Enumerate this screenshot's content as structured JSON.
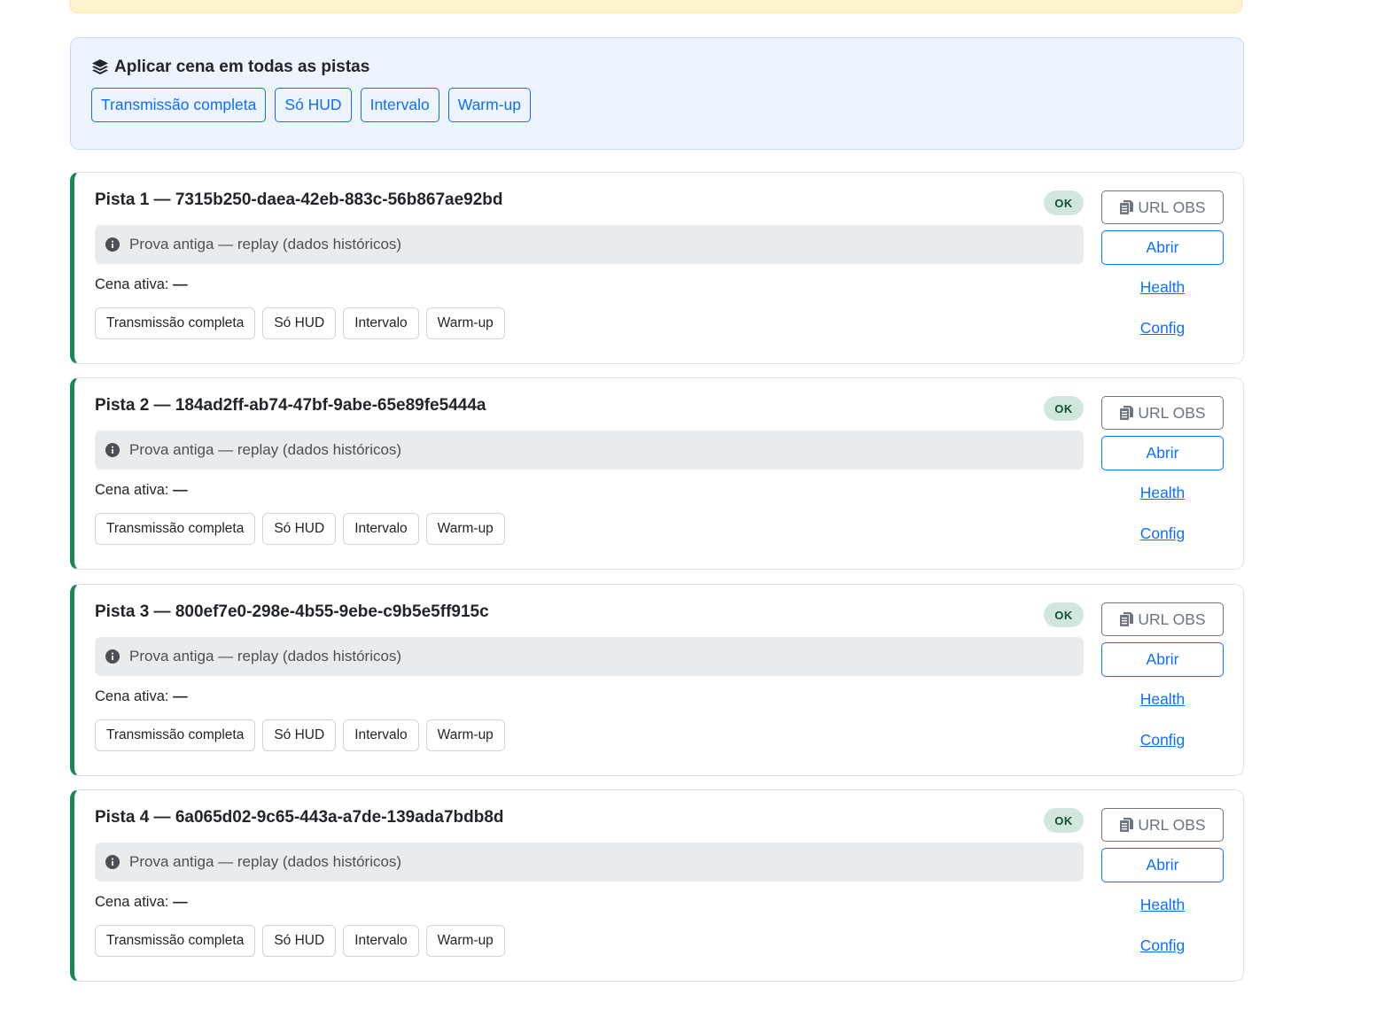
{
  "scene_panel": {
    "title": "Aplicar cena em todas as pistas",
    "icon": "layers-icon",
    "buttons": [
      "Transmissão completa",
      "Só HUD",
      "Intervalo",
      "Warm-up"
    ]
  },
  "colors": {
    "accent": "#0d6efd",
    "ok": "#198754",
    "warning_strip": "#fff3cd",
    "panel_bg": "#eef4fe"
  },
  "lanes": [
    {
      "title": "Pista 1 — 7315b250-daea-42eb-883c-56b867ae92bd",
      "status": "OK",
      "info": "Prova antiga — replay (dados históricos)",
      "cena_label": "Cena ativa:",
      "cena_value": "—",
      "scene_buttons": [
        "Transmissão completa",
        "Só HUD",
        "Intervalo",
        "Warm-up"
      ],
      "url_obs_label": "URL OBS",
      "abrir_label": "Abrir",
      "health_label": "Health",
      "config_label": "Config"
    },
    {
      "title": "Pista 2 — 184ad2ff-ab74-47bf-9abe-65e89fe5444a",
      "status": "OK",
      "info": "Prova antiga — replay (dados históricos)",
      "cena_label": "Cena ativa:",
      "cena_value": "—",
      "scene_buttons": [
        "Transmissão completa",
        "Só HUD",
        "Intervalo",
        "Warm-up"
      ],
      "url_obs_label": "URL OBS",
      "abrir_label": "Abrir",
      "health_label": "Health",
      "config_label": "Config"
    },
    {
      "title": "Pista 3 — 800ef7e0-298e-4b55-9ebe-c9b5e5ff915c",
      "status": "OK",
      "info": "Prova antiga — replay (dados históricos)",
      "cena_label": "Cena ativa:",
      "cena_value": "—",
      "scene_buttons": [
        "Transmissão completa",
        "Só HUD",
        "Intervalo",
        "Warm-up"
      ],
      "url_obs_label": "URL OBS",
      "abrir_label": "Abrir",
      "health_label": "Health",
      "config_label": "Config"
    },
    {
      "title": "Pista 4 — 6a065d02-9c65-443a-a7de-139ada7bdb8d",
      "status": "OK",
      "info": "Prova antiga — replay (dados históricos)",
      "cena_label": "Cena ativa:",
      "cena_value": "—",
      "scene_buttons": [
        "Transmissão completa",
        "Só HUD",
        "Intervalo",
        "Warm-up"
      ],
      "url_obs_label": "URL OBS",
      "abrir_label": "Abrir",
      "health_label": "Health",
      "config_label": "Config"
    }
  ]
}
